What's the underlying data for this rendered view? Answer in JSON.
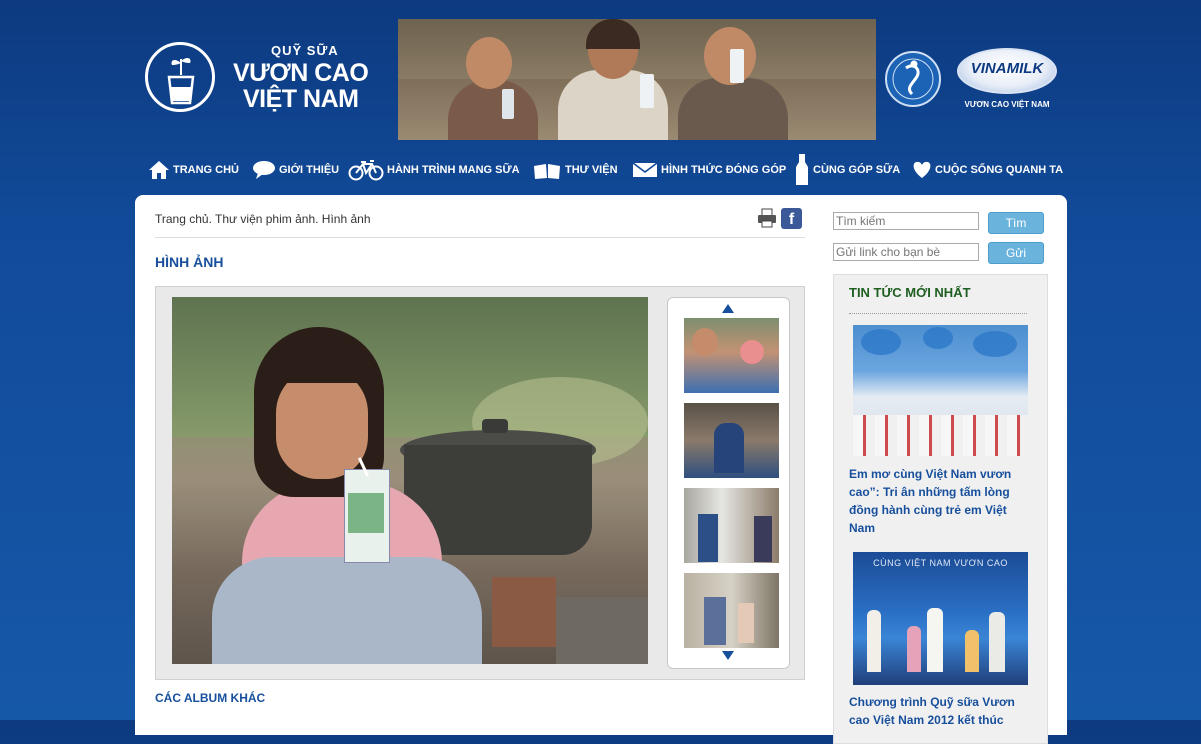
{
  "brand": {
    "small": "QUỸ SỮA",
    "line1": "VƯƠN CAO",
    "line2": "VIỆT NAM",
    "partner_name": "VINAMILK",
    "partner_sub": "VƯƠN CAO VIỆT NAM"
  },
  "nav": [
    {
      "label": "TRANG CHỦ",
      "icon": "home-icon"
    },
    {
      "label": "GIỚI THIỆU",
      "icon": "speech-bubble-icon"
    },
    {
      "label": "HÀNH TRÌNH MANG SỮA",
      "icon": "bicycle-icon"
    },
    {
      "label": "THƯ VIỆN",
      "icon": "book-icon"
    },
    {
      "label": "HÌNH THỨC ĐÓNG GÓP",
      "icon": "envelope-icon"
    },
    {
      "label": "CÙNG GÓP SỮA",
      "icon": "milk-bottle-icon"
    },
    {
      "label": "CUỘC SỐNG QUANH TA",
      "icon": "heart-icon"
    }
  ],
  "breadcrumb": "Trang chủ. Thư viện phim ảnh. Hình ảnh",
  "page_title": "HÌNH ẢNH",
  "other_albums": "CÁC ALBUM KHÁC",
  "sidebar": {
    "search_placeholder": "Tìm kiếm",
    "search_button": "Tìm",
    "share_placeholder": "Gửi link cho bạn bè",
    "share_button": "Gửi",
    "news_title": "TIN TỨC MỚI NHẤT",
    "news": [
      {
        "title": "Em mơ cùng Việt Nam vươn cao”: Tri ân những tấm lòng đồng hành cùng trẻ em Việt Nam"
      },
      {
        "title": "Chương trình Quỹ sữa Vươn cao Việt Nam 2012 kết thúc"
      }
    ],
    "news2_banner_text": "CÙNG VIỆT NAM VƯƠN CAO"
  },
  "colors": {
    "background": "#114a98",
    "accent": "#174f9c",
    "news_title": "#1e5f20",
    "button": "#6ab3dd"
  }
}
